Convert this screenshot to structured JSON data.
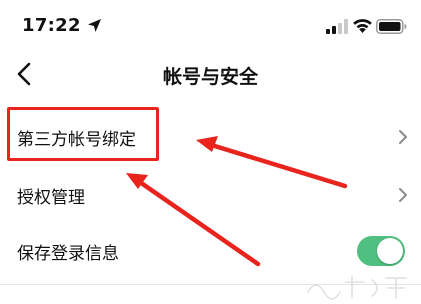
{
  "status_bar": {
    "time": "17:22",
    "icons": [
      "location-arrow-icon",
      "cellular-signal-icon",
      "wifi-icon",
      "battery-icon"
    ]
  },
  "nav": {
    "back_icon": "chevron-left-icon",
    "title": "帐号与安全"
  },
  "settings": {
    "items": [
      {
        "label": "第三方帐号绑定",
        "accessory": "chevron-right-icon"
      },
      {
        "label": "授权管理",
        "accessory": "chevron-right-icon"
      },
      {
        "label": "保存登录信息",
        "accessory": "toggle",
        "toggle_on": true
      }
    ]
  },
  "annotations": {
    "color": "#e8241d",
    "highlight": "第三方帐号绑定",
    "arrows": 2
  },
  "colors": {
    "toggle_on": "#4fc07f",
    "text": "#111111",
    "chevron": "#8a8a8a",
    "background": "#ffffff"
  }
}
